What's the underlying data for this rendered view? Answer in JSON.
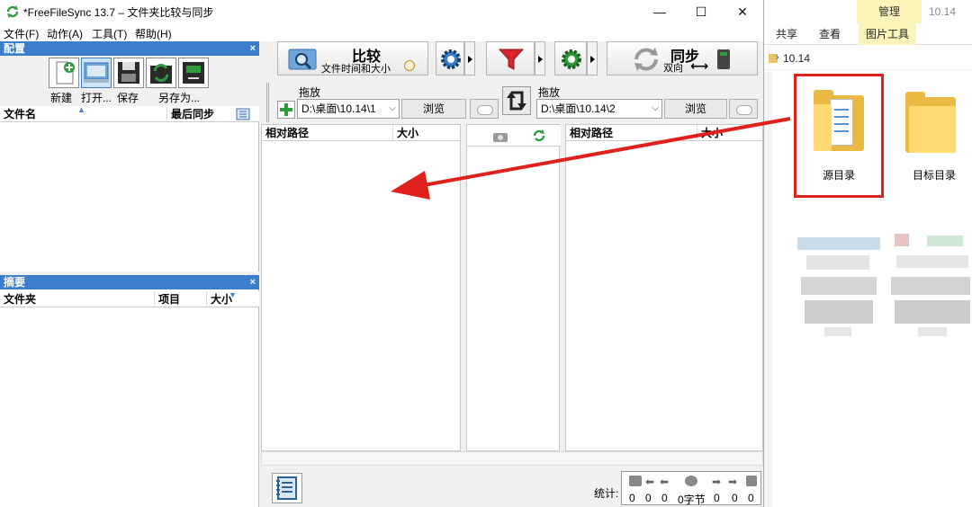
{
  "window": {
    "title": "*FreeFileSync 13.7 – 文件夹比较与同步",
    "minimize": "—",
    "maximize": "☐",
    "close": "✕"
  },
  "menu": [
    "文件(F)",
    "动作(A)",
    "工具(T)",
    "帮助(H)"
  ],
  "config_panel": {
    "title": "配置",
    "close": "×",
    "buttons": [
      {
        "label": "新建",
        "icon": "new-config-icon"
      },
      {
        "label": "打开...",
        "icon": "open-config-icon"
      },
      {
        "label": "保存",
        "icon": "save-icon"
      },
      {
        "label": "另存为...",
        "icon": "save-as-icon"
      }
    ],
    "col_filename": "文件名",
    "col_last_sync": "最后同步"
  },
  "summary_panel": {
    "title": "摘要",
    "close": "×",
    "col_folder": "文件夹",
    "col_items": "项目",
    "col_size": "大小"
  },
  "toolbar": {
    "compare_label": "比较",
    "compare_sub": "文件时间和大小",
    "sync_label": "同步",
    "sync_sub": "双向"
  },
  "left_folder": {
    "drop_label": "拖放",
    "path": "D:\\桌面\\10.14\\1",
    "browse": "浏览"
  },
  "right_folder": {
    "drop_label": "拖放",
    "path": "D:\\桌面\\10.14\\2",
    "browse": "浏览"
  },
  "grid": {
    "left_col_path": "相对路径",
    "left_col_size": "大小",
    "right_col_path": "相对路径",
    "right_col_size": "大小"
  },
  "stats": {
    "label": "统计:",
    "values": [
      "0",
      "0",
      "0",
      "0字节",
      "0",
      "0",
      "0"
    ]
  },
  "explorer": {
    "manage_tab": "管理",
    "title_path": "10.14",
    "tabs": [
      "共享",
      "查看",
      "图片工具"
    ],
    "address": "10.14",
    "folders": [
      {
        "label": "源目录"
      },
      {
        "label": "目标目录"
      }
    ]
  },
  "colors": {
    "accent_blue": "#3b7ecb",
    "annotation_red": "#e0201b",
    "folder_yellow": "#ffd971"
  }
}
